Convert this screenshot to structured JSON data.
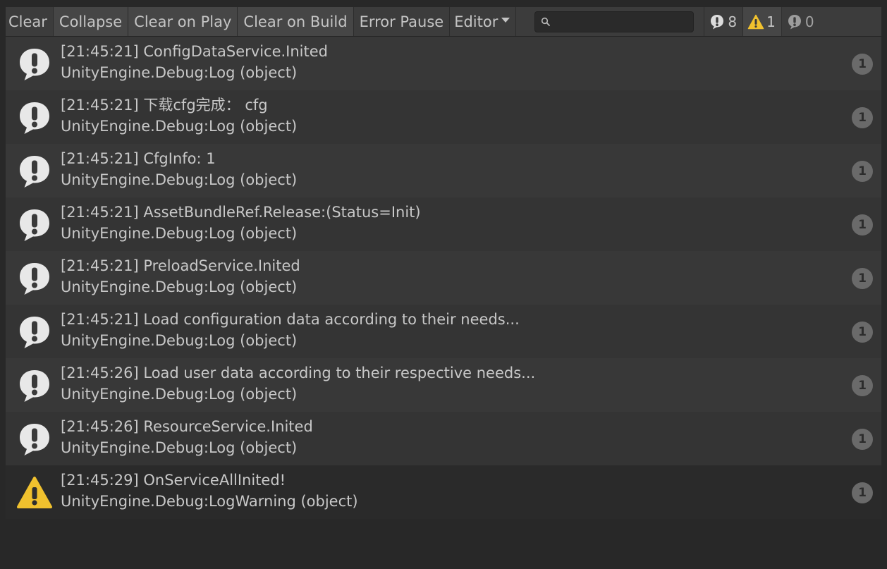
{
  "toolbar": {
    "clear": "Clear",
    "collapse": "Collapse",
    "clear_on_play": "Clear on Play",
    "clear_on_build": "Clear on Build",
    "error_pause": "Error Pause",
    "editor": "Editor",
    "search_value": "",
    "info_count": "8",
    "warning_count": "1",
    "error_count": "0"
  },
  "colors": {
    "info_icon": "#e8e8e8",
    "warning_icon": "#f0c12e",
    "badge_bg": "#6a6a6a"
  },
  "logs": [
    {
      "type": "info",
      "icon": "info-bubble-icon",
      "message": "[21:45:21] ConfigDataService.Inited",
      "stack": "UnityEngine.Debug:Log (object)",
      "count": "1"
    },
    {
      "type": "info",
      "icon": "info-bubble-icon",
      "message": "[21:45:21] 下载cfg完成： cfg",
      "stack": "UnityEngine.Debug:Log (object)",
      "count": "1"
    },
    {
      "type": "info",
      "icon": "info-bubble-icon",
      "message": "[21:45:21] CfgInfo: 1",
      "stack": "UnityEngine.Debug:Log (object)",
      "count": "1"
    },
    {
      "type": "info",
      "icon": "info-bubble-icon",
      "message": "[21:45:21] AssetBundleRef.Release:(Status=Init)",
      "stack": "UnityEngine.Debug:Log (object)",
      "count": "1"
    },
    {
      "type": "info",
      "icon": "info-bubble-icon",
      "message": "[21:45:21] PreloadService.Inited",
      "stack": "UnityEngine.Debug:Log (object)",
      "count": "1"
    },
    {
      "type": "info",
      "icon": "info-bubble-icon",
      "message": "[21:45:21] Load configuration data according to their needs...",
      "stack": "UnityEngine.Debug:Log (object)",
      "count": "1"
    },
    {
      "type": "info",
      "icon": "info-bubble-icon",
      "message": "[21:45:26] Load user data according to their respective needs...",
      "stack": "UnityEngine.Debug:Log (object)",
      "count": "1"
    },
    {
      "type": "info",
      "icon": "info-bubble-icon",
      "message": "[21:45:26] ResourceService.Inited",
      "stack": "UnityEngine.Debug:Log (object)",
      "count": "1"
    },
    {
      "type": "warning",
      "icon": "warning-triangle-icon",
      "message": "[21:45:29] OnServiceAllInited!",
      "stack": "UnityEngine.Debug:LogWarning (object)",
      "count": "1"
    }
  ]
}
